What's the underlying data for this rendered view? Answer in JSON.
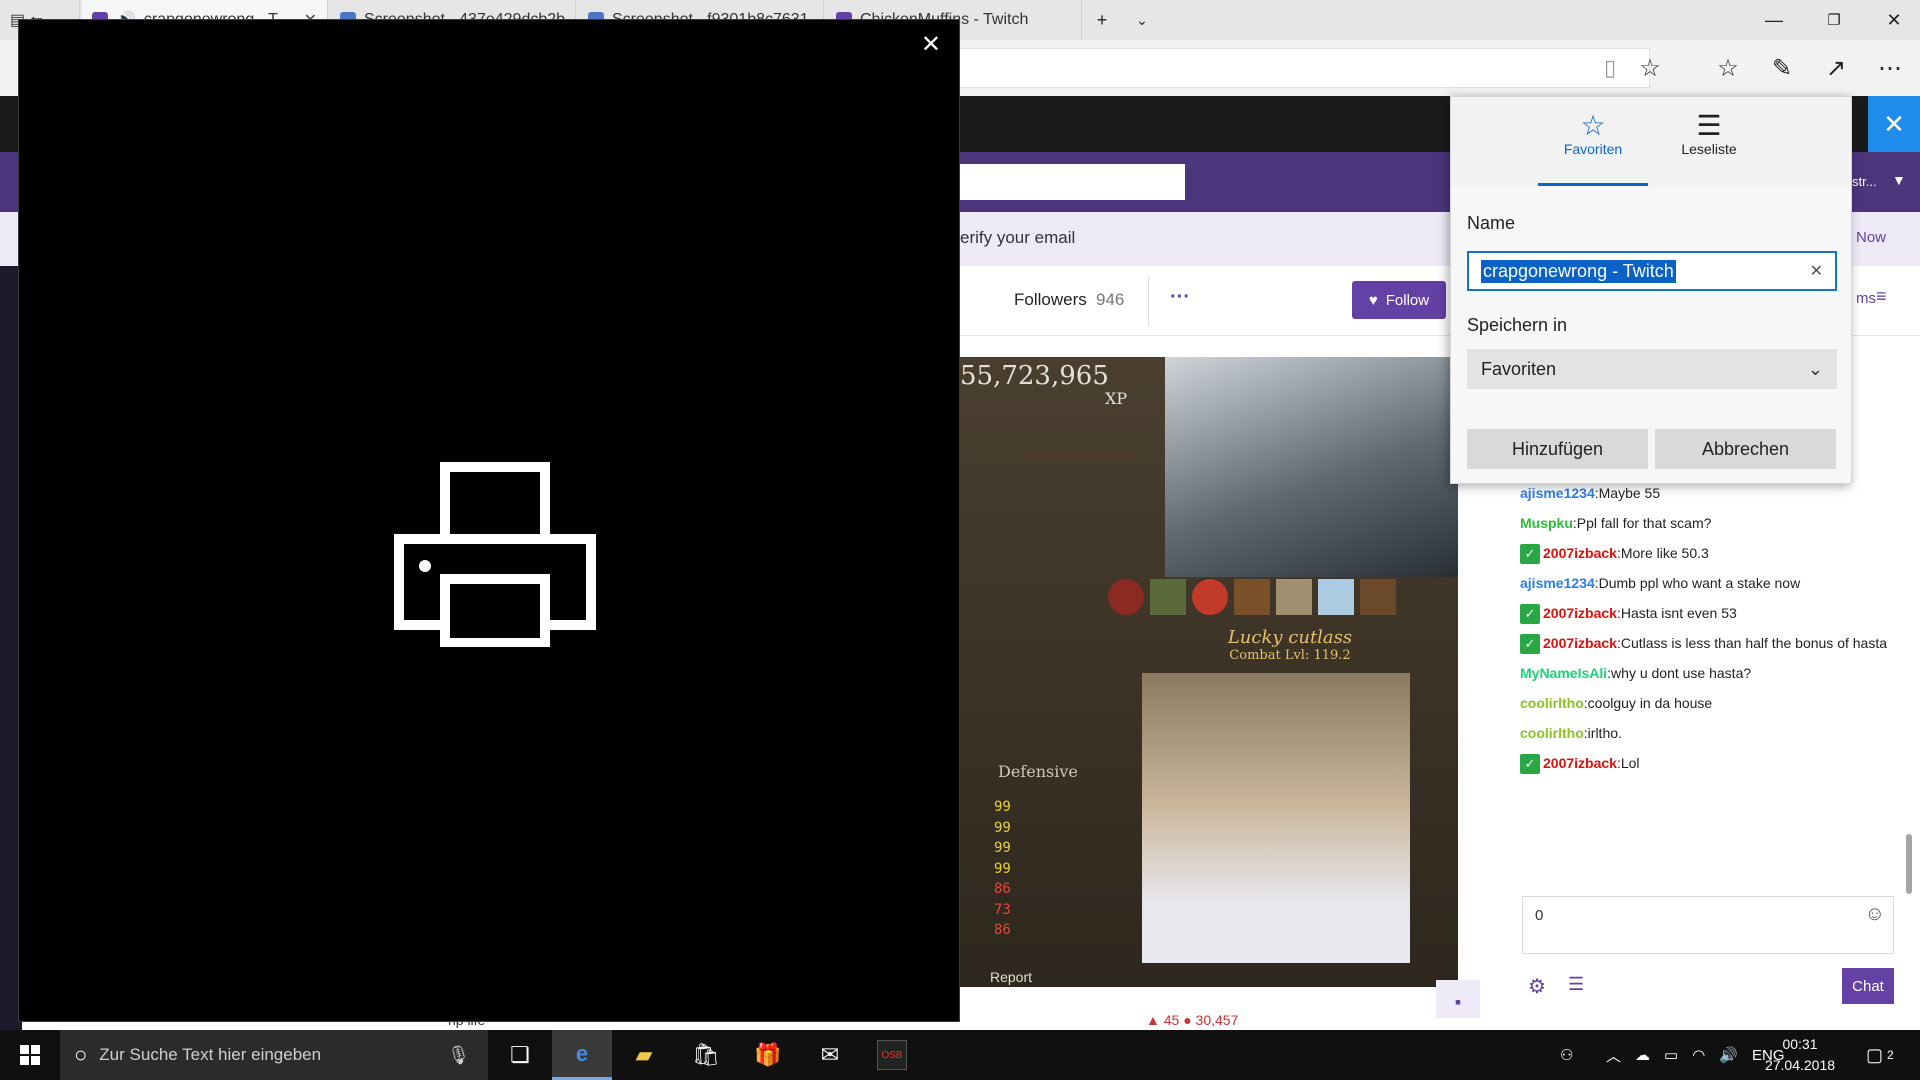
{
  "tabs": [
    {
      "title": "crapgonewrong - T",
      "active": true,
      "color": "#6441a4"
    },
    {
      "title": "Screenshot - 437e429dcb2b",
      "active": false,
      "color": "#4a78c4"
    },
    {
      "title": "Screenshot - f9301b8c7631",
      "active": false,
      "color": "#4a78c4"
    },
    {
      "title": "ChickenMuffins - Twitch",
      "active": false,
      "color": "#6441a4"
    }
  ],
  "channel": {
    "verify_text": "erify your email",
    "followers_label": "Followers",
    "followers_count": "946",
    "follow_label": "Follow",
    "now_label": "Now",
    "items_label": "ms"
  },
  "video": {
    "xp_value": "55,723,965",
    "xp_label": "XP",
    "loot_name": "Lucky cutlass",
    "loot_combat": "Combat Lvl: 119.2",
    "defensive_label": "Defensive",
    "report_label": "Report",
    "stats": [
      "99",
      "99",
      "99",
      "99",
      "86",
      "73",
      "86"
    ]
  },
  "chat": {
    "messages": [
      {
        "user": "ajisme1234",
        "color": "#2e7ce8",
        "badge": false,
        "text": "Maybe 55"
      },
      {
        "user": "Muspku",
        "color": "#2bbf3b",
        "badge": false,
        "text": "Ppl fall for that scam?"
      },
      {
        "user": "2007izback",
        "color": "#e01010",
        "badge": true,
        "text": "More like 50.3"
      },
      {
        "user": "ajisme1234",
        "color": "#2e7ce8",
        "badge": false,
        "text": "Dumb ppl who want a stake now"
      },
      {
        "user": "2007izback",
        "color": "#e01010",
        "badge": true,
        "text": "Hasta isnt even 53"
      },
      {
        "user": "2007izback",
        "color": "#e01010",
        "badge": true,
        "text": "Cutlass is less than half the bonus of hasta"
      },
      {
        "user": "MyNameIsAli",
        "color": "#22d07a",
        "badge": false,
        "text": "why u dont use hasta?"
      },
      {
        "user": "coolirltho",
        "color": "#8dc21f",
        "badge": false,
        "text": "coolguy in da house"
      },
      {
        "user": "coolirltho",
        "color": "#8dc21f",
        "badge": false,
        "text": "irltho."
      },
      {
        "user": "2007izback",
        "color": "#e01010",
        "badge": true,
        "text": "Lol"
      }
    ],
    "input_value": "0",
    "chat_button": "Chat"
  },
  "favorites": {
    "tab_favorites": "Favoriten",
    "tab_reading": "Leseliste",
    "name_label": "Name",
    "name_value": "crapgonewrong - Twitch",
    "save_in_label": "Speichern in",
    "save_in_value": "Favoriten",
    "add_button": "Hinzufügen",
    "cancel_button": "Abbrechen"
  },
  "bottom": {
    "left_text": "rip life",
    "right_text": "▲ 45   ● 30,457"
  },
  "taskbar": {
    "search_placeholder": "Zur Suche Text hier eingeben",
    "language": "ENG",
    "time": "00:31",
    "date": "27.04.2018",
    "notifications": "2",
    "app_label": "OSB"
  },
  "colors": {
    "accent": "#0a66c2",
    "twitch_purple": "#6441a4"
  }
}
